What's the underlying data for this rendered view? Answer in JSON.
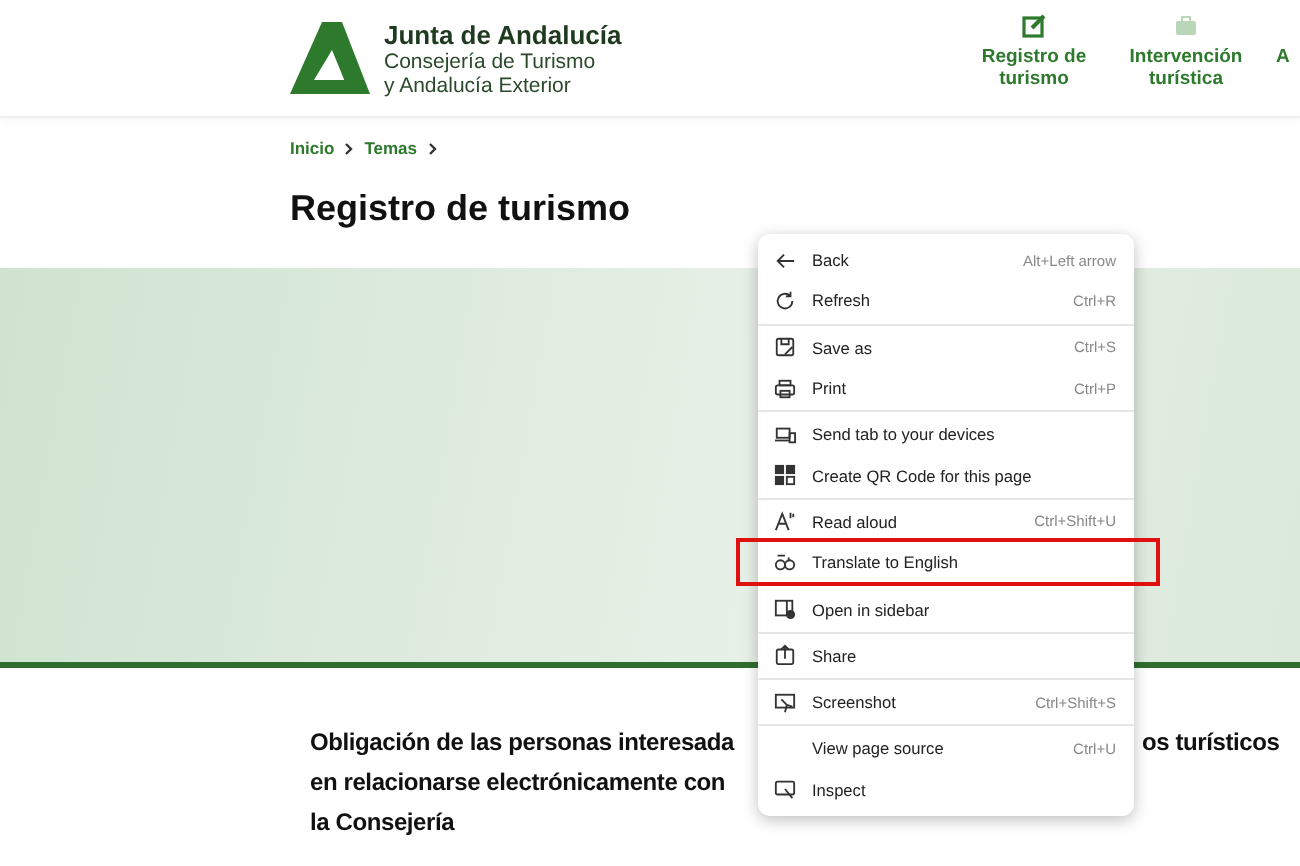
{
  "header": {
    "brand": "Junta de Andalucía",
    "subtitle_lines": [
      "Consejería de Turismo",
      "y Andalucía Exterior"
    ],
    "nav": [
      {
        "kind": "edit",
        "label_lines": [
          "Registro de",
          "turismo"
        ]
      },
      {
        "kind": "briefcase",
        "label_lines": [
          "Intervención",
          "turística"
        ]
      },
      {
        "kind": "none",
        "label_lines": [
          "A"
        ]
      }
    ]
  },
  "breadcrumb": [
    "Inicio",
    "Temas"
  ],
  "page_title": "Registro de turismo",
  "section": {
    "heading_lines": [
      "Obligación de las personas interesada",
      "en relacionarse electrónicamente con",
      "la Consejería"
    ],
    "heading_right_fragment": "os turísticos"
  },
  "context_menu": {
    "groups": [
      [
        {
          "kind": "back",
          "label": "Back",
          "shortcut": "Alt+Left arrow",
          "highlighted": false
        },
        {
          "kind": "refresh",
          "label": "Refresh",
          "shortcut": "Ctrl+R",
          "highlighted": false
        }
      ],
      [
        {
          "kind": "save",
          "label": "Save as",
          "shortcut": "Ctrl+S",
          "highlighted": false
        },
        {
          "kind": "print",
          "label": "Print",
          "shortcut": "Ctrl+P",
          "highlighted": false
        }
      ],
      [
        {
          "kind": "devices",
          "label": "Send tab to your devices",
          "highlighted": false
        },
        {
          "kind": "qr",
          "label": "Create QR Code for this page",
          "highlighted": false
        }
      ],
      [
        {
          "kind": "read",
          "label": "Read aloud",
          "shortcut": "Ctrl+Shift+U",
          "highlighted": false
        },
        {
          "kind": "translate",
          "label": "Translate to English",
          "highlighted": true
        }
      ],
      [
        {
          "kind": "sidebar",
          "label": "Open in sidebar",
          "highlighted": false
        }
      ],
      [
        {
          "kind": "share",
          "label": "Share",
          "highlighted": false
        }
      ],
      [
        {
          "kind": "screenshot",
          "label": "Screenshot",
          "shortcut": "Ctrl+Shift+S",
          "highlighted": false
        }
      ],
      [
        {
          "kind": "plain",
          "label": "View page source",
          "shortcut": "Ctrl+U",
          "highlighted": false
        },
        {
          "kind": "inspect",
          "label": "Inspect",
          "highlighted": false
        }
      ]
    ]
  }
}
